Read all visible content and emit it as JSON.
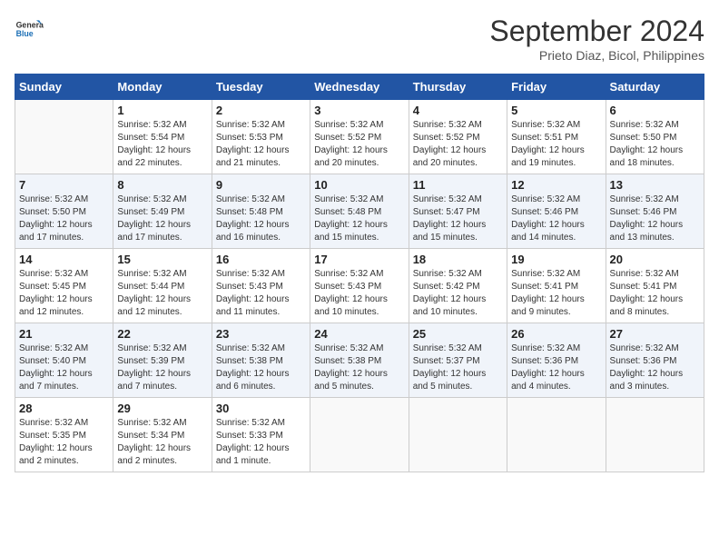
{
  "header": {
    "logo_line1": "General",
    "logo_line2": "Blue",
    "month": "September 2024",
    "location": "Prieto Diaz, Bicol, Philippines"
  },
  "weekdays": [
    "Sunday",
    "Monday",
    "Tuesday",
    "Wednesday",
    "Thursday",
    "Friday",
    "Saturday"
  ],
  "days": [
    {
      "num": "",
      "info": ""
    },
    {
      "num": "1",
      "info": "Sunrise: 5:32 AM\nSunset: 5:54 PM\nDaylight: 12 hours\nand 22 minutes."
    },
    {
      "num": "2",
      "info": "Sunrise: 5:32 AM\nSunset: 5:53 PM\nDaylight: 12 hours\nand 21 minutes."
    },
    {
      "num": "3",
      "info": "Sunrise: 5:32 AM\nSunset: 5:52 PM\nDaylight: 12 hours\nand 20 minutes."
    },
    {
      "num": "4",
      "info": "Sunrise: 5:32 AM\nSunset: 5:52 PM\nDaylight: 12 hours\nand 20 minutes."
    },
    {
      "num": "5",
      "info": "Sunrise: 5:32 AM\nSunset: 5:51 PM\nDaylight: 12 hours\nand 19 minutes."
    },
    {
      "num": "6",
      "info": "Sunrise: 5:32 AM\nSunset: 5:50 PM\nDaylight: 12 hours\nand 18 minutes."
    },
    {
      "num": "7",
      "info": "Sunrise: 5:32 AM\nSunset: 5:50 PM\nDaylight: 12 hours\nand 17 minutes."
    },
    {
      "num": "8",
      "info": "Sunrise: 5:32 AM\nSunset: 5:49 PM\nDaylight: 12 hours\nand 17 minutes."
    },
    {
      "num": "9",
      "info": "Sunrise: 5:32 AM\nSunset: 5:48 PM\nDaylight: 12 hours\nand 16 minutes."
    },
    {
      "num": "10",
      "info": "Sunrise: 5:32 AM\nSunset: 5:48 PM\nDaylight: 12 hours\nand 15 minutes."
    },
    {
      "num": "11",
      "info": "Sunrise: 5:32 AM\nSunset: 5:47 PM\nDaylight: 12 hours\nand 15 minutes."
    },
    {
      "num": "12",
      "info": "Sunrise: 5:32 AM\nSunset: 5:46 PM\nDaylight: 12 hours\nand 14 minutes."
    },
    {
      "num": "13",
      "info": "Sunrise: 5:32 AM\nSunset: 5:46 PM\nDaylight: 12 hours\nand 13 minutes."
    },
    {
      "num": "14",
      "info": "Sunrise: 5:32 AM\nSunset: 5:45 PM\nDaylight: 12 hours\nand 12 minutes."
    },
    {
      "num": "15",
      "info": "Sunrise: 5:32 AM\nSunset: 5:44 PM\nDaylight: 12 hours\nand 12 minutes."
    },
    {
      "num": "16",
      "info": "Sunrise: 5:32 AM\nSunset: 5:43 PM\nDaylight: 12 hours\nand 11 minutes."
    },
    {
      "num": "17",
      "info": "Sunrise: 5:32 AM\nSunset: 5:43 PM\nDaylight: 12 hours\nand 10 minutes."
    },
    {
      "num": "18",
      "info": "Sunrise: 5:32 AM\nSunset: 5:42 PM\nDaylight: 12 hours\nand 10 minutes."
    },
    {
      "num": "19",
      "info": "Sunrise: 5:32 AM\nSunset: 5:41 PM\nDaylight: 12 hours\nand 9 minutes."
    },
    {
      "num": "20",
      "info": "Sunrise: 5:32 AM\nSunset: 5:41 PM\nDaylight: 12 hours\nand 8 minutes."
    },
    {
      "num": "21",
      "info": "Sunrise: 5:32 AM\nSunset: 5:40 PM\nDaylight: 12 hours\nand 7 minutes."
    },
    {
      "num": "22",
      "info": "Sunrise: 5:32 AM\nSunset: 5:39 PM\nDaylight: 12 hours\nand 7 minutes."
    },
    {
      "num": "23",
      "info": "Sunrise: 5:32 AM\nSunset: 5:38 PM\nDaylight: 12 hours\nand 6 minutes."
    },
    {
      "num": "24",
      "info": "Sunrise: 5:32 AM\nSunset: 5:38 PM\nDaylight: 12 hours\nand 5 minutes."
    },
    {
      "num": "25",
      "info": "Sunrise: 5:32 AM\nSunset: 5:37 PM\nDaylight: 12 hours\nand 5 minutes."
    },
    {
      "num": "26",
      "info": "Sunrise: 5:32 AM\nSunset: 5:36 PM\nDaylight: 12 hours\nand 4 minutes."
    },
    {
      "num": "27",
      "info": "Sunrise: 5:32 AM\nSunset: 5:36 PM\nDaylight: 12 hours\nand 3 minutes."
    },
    {
      "num": "28",
      "info": "Sunrise: 5:32 AM\nSunset: 5:35 PM\nDaylight: 12 hours\nand 2 minutes."
    },
    {
      "num": "29",
      "info": "Sunrise: 5:32 AM\nSunset: 5:34 PM\nDaylight: 12 hours\nand 2 minutes."
    },
    {
      "num": "30",
      "info": "Sunrise: 5:32 AM\nSunset: 5:33 PM\nDaylight: 12 hours\nand 1 minute."
    },
    {
      "num": "",
      "info": ""
    },
    {
      "num": "",
      "info": ""
    },
    {
      "num": "",
      "info": ""
    },
    {
      "num": "",
      "info": ""
    }
  ],
  "rows": [
    [
      0,
      1,
      2,
      3,
      4,
      5,
      6
    ],
    [
      7,
      8,
      9,
      10,
      11,
      12,
      13
    ],
    [
      14,
      15,
      16,
      17,
      18,
      19,
      20
    ],
    [
      21,
      22,
      23,
      24,
      25,
      26,
      27
    ],
    [
      28,
      29,
      30,
      31,
      32,
      33,
      34
    ]
  ]
}
